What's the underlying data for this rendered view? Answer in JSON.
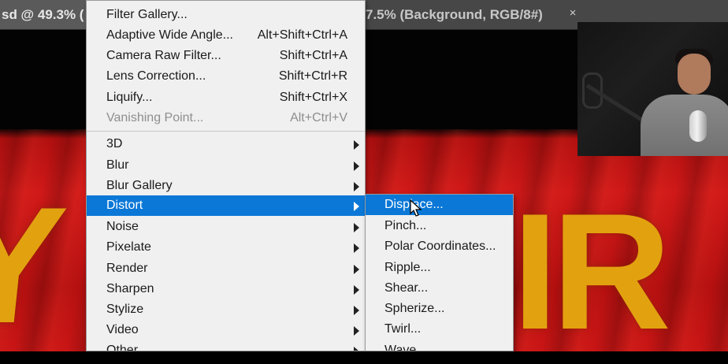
{
  "tabs": {
    "left_title": "sd @ 49.3% (",
    "right_title": "7.5% (Background, RGB/8#)",
    "close_glyph": "×"
  },
  "filter_menu": {
    "top_items": [
      {
        "label": "Filter Gallery...",
        "shortcut": ""
      },
      {
        "label": "Adaptive Wide Angle...",
        "shortcut": "Alt+Shift+Ctrl+A"
      },
      {
        "label": "Camera Raw Filter...",
        "shortcut": "Shift+Ctrl+A"
      },
      {
        "label": "Lens Correction...",
        "shortcut": "Shift+Ctrl+R"
      },
      {
        "label": "Liquify...",
        "shortcut": "Shift+Ctrl+X"
      },
      {
        "label": "Vanishing Point...",
        "shortcut": "Alt+Ctrl+V",
        "disabled": true
      }
    ],
    "submenus": [
      {
        "label": "3D"
      },
      {
        "label": "Blur"
      },
      {
        "label": "Blur Gallery"
      },
      {
        "label": "Distort",
        "selected": true
      },
      {
        "label": "Noise"
      },
      {
        "label": "Pixelate"
      },
      {
        "label": "Render"
      },
      {
        "label": "Sharpen"
      },
      {
        "label": "Stylize"
      },
      {
        "label": "Video"
      },
      {
        "label": "Other"
      }
    ]
  },
  "distort_menu": {
    "items": [
      {
        "label": "Displace...",
        "selected": true
      },
      {
        "label": "Pinch..."
      },
      {
        "label": "Polar Coordinates..."
      },
      {
        "label": "Ripple..."
      },
      {
        "label": "Shear..."
      },
      {
        "label": "Spherize..."
      },
      {
        "label": "Twirl..."
      },
      {
        "label": "Wave..."
      }
    ]
  },
  "canvas": {
    "flag_letters_left": "Y",
    "flag_letters_right": "IR"
  },
  "colors": {
    "menu_bg": "#f0f0f0",
    "highlight": "#0b78d7",
    "flag_red": "#cf1818",
    "flag_gold": "#e2a20f"
  }
}
